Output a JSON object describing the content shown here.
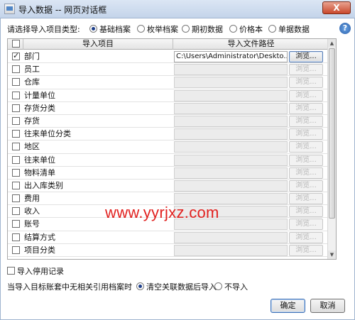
{
  "window": {
    "title": "导入数据 -- 网页对话框",
    "close_label": "X",
    "help_glyph": "?"
  },
  "import_type": {
    "label": "请选择导入项目类型:",
    "options": [
      "基础档案",
      "枚举档案",
      "期初数据",
      "价格本",
      "单据数据"
    ],
    "selected": "基础档案"
  },
  "grid": {
    "columns": {
      "item": "导入项目",
      "path": "导入文件路径"
    },
    "browse_label": "浏览...",
    "rows": [
      {
        "name": "部门",
        "checked": true,
        "path": "C:\\Users\\Administrator\\Deskto...",
        "enabled": true
      },
      {
        "name": "员工",
        "checked": false,
        "path": "",
        "enabled": false
      },
      {
        "name": "仓库",
        "checked": false,
        "path": "",
        "enabled": false
      },
      {
        "name": "计量单位",
        "checked": false,
        "path": "",
        "enabled": false
      },
      {
        "name": "存货分类",
        "checked": false,
        "path": "",
        "enabled": false
      },
      {
        "name": "存货",
        "checked": false,
        "path": "",
        "enabled": false
      },
      {
        "name": "往来单位分类",
        "checked": false,
        "path": "",
        "enabled": false
      },
      {
        "name": "地区",
        "checked": false,
        "path": "",
        "enabled": false
      },
      {
        "name": "往来单位",
        "checked": false,
        "path": "",
        "enabled": false
      },
      {
        "name": "物料清单",
        "checked": false,
        "path": "",
        "enabled": false
      },
      {
        "name": "出入库类别",
        "checked": false,
        "path": "",
        "enabled": false
      },
      {
        "name": "费用",
        "checked": false,
        "path": "",
        "enabled": false
      },
      {
        "name": "收入",
        "checked": false,
        "path": "",
        "enabled": false
      },
      {
        "name": "账号",
        "checked": false,
        "path": "",
        "enabled": false
      },
      {
        "name": "结算方式",
        "checked": false,
        "path": "",
        "enabled": false
      },
      {
        "name": "项目分类",
        "checked": false,
        "path": "",
        "enabled": false
      }
    ]
  },
  "watermark": "www.yyrjxz.com",
  "import_disabled": {
    "label": "导入停用记录",
    "checked": false
  },
  "no_ref": {
    "label": "当导入目标账套中无相关引用档案时",
    "options": [
      "清空关联数据后导入",
      "不导入"
    ],
    "selected": "清空关联数据后导入"
  },
  "buttons": {
    "ok": "确定",
    "cancel": "取消"
  }
}
